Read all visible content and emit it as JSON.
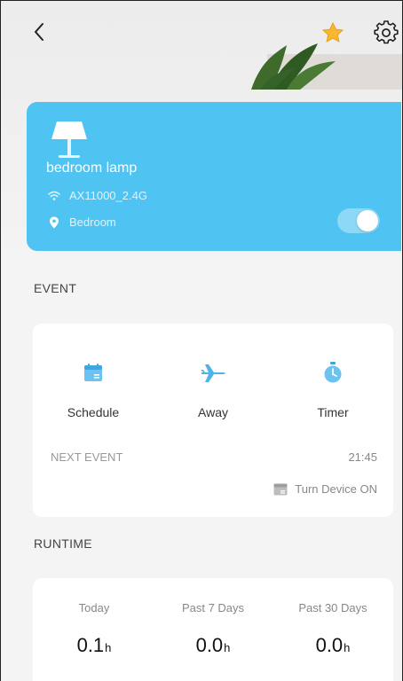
{
  "device": {
    "name": "bedroom lamp",
    "wifi": "AX11000_2.4G",
    "room": "Bedroom",
    "power_on": true,
    "card_color": "#4fc3f2"
  },
  "event": {
    "section_title": "EVENT",
    "items": [
      {
        "label": "Schedule",
        "icon": "calendar-icon"
      },
      {
        "label": "Away",
        "icon": "airplane-icon"
      },
      {
        "label": "Timer",
        "icon": "stopwatch-icon"
      }
    ],
    "next_event_label": "NEXT EVENT",
    "next_event_time": "21:45",
    "next_event_action": "Turn Device ON"
  },
  "runtime": {
    "section_title": "RUNTIME",
    "columns": [
      {
        "label": "Today",
        "value": "0.1",
        "unit": "h"
      },
      {
        "label": "Past 7 Days",
        "value": "0.0",
        "unit": "h"
      },
      {
        "label": "Past 30 Days",
        "value": "0.0",
        "unit": "h"
      }
    ]
  },
  "icons": {
    "back": "chevron-left-icon",
    "favorite": "star-icon",
    "settings": "gear-icon"
  },
  "colors": {
    "accent": "#4fc3f2",
    "star": "#f7b731"
  }
}
